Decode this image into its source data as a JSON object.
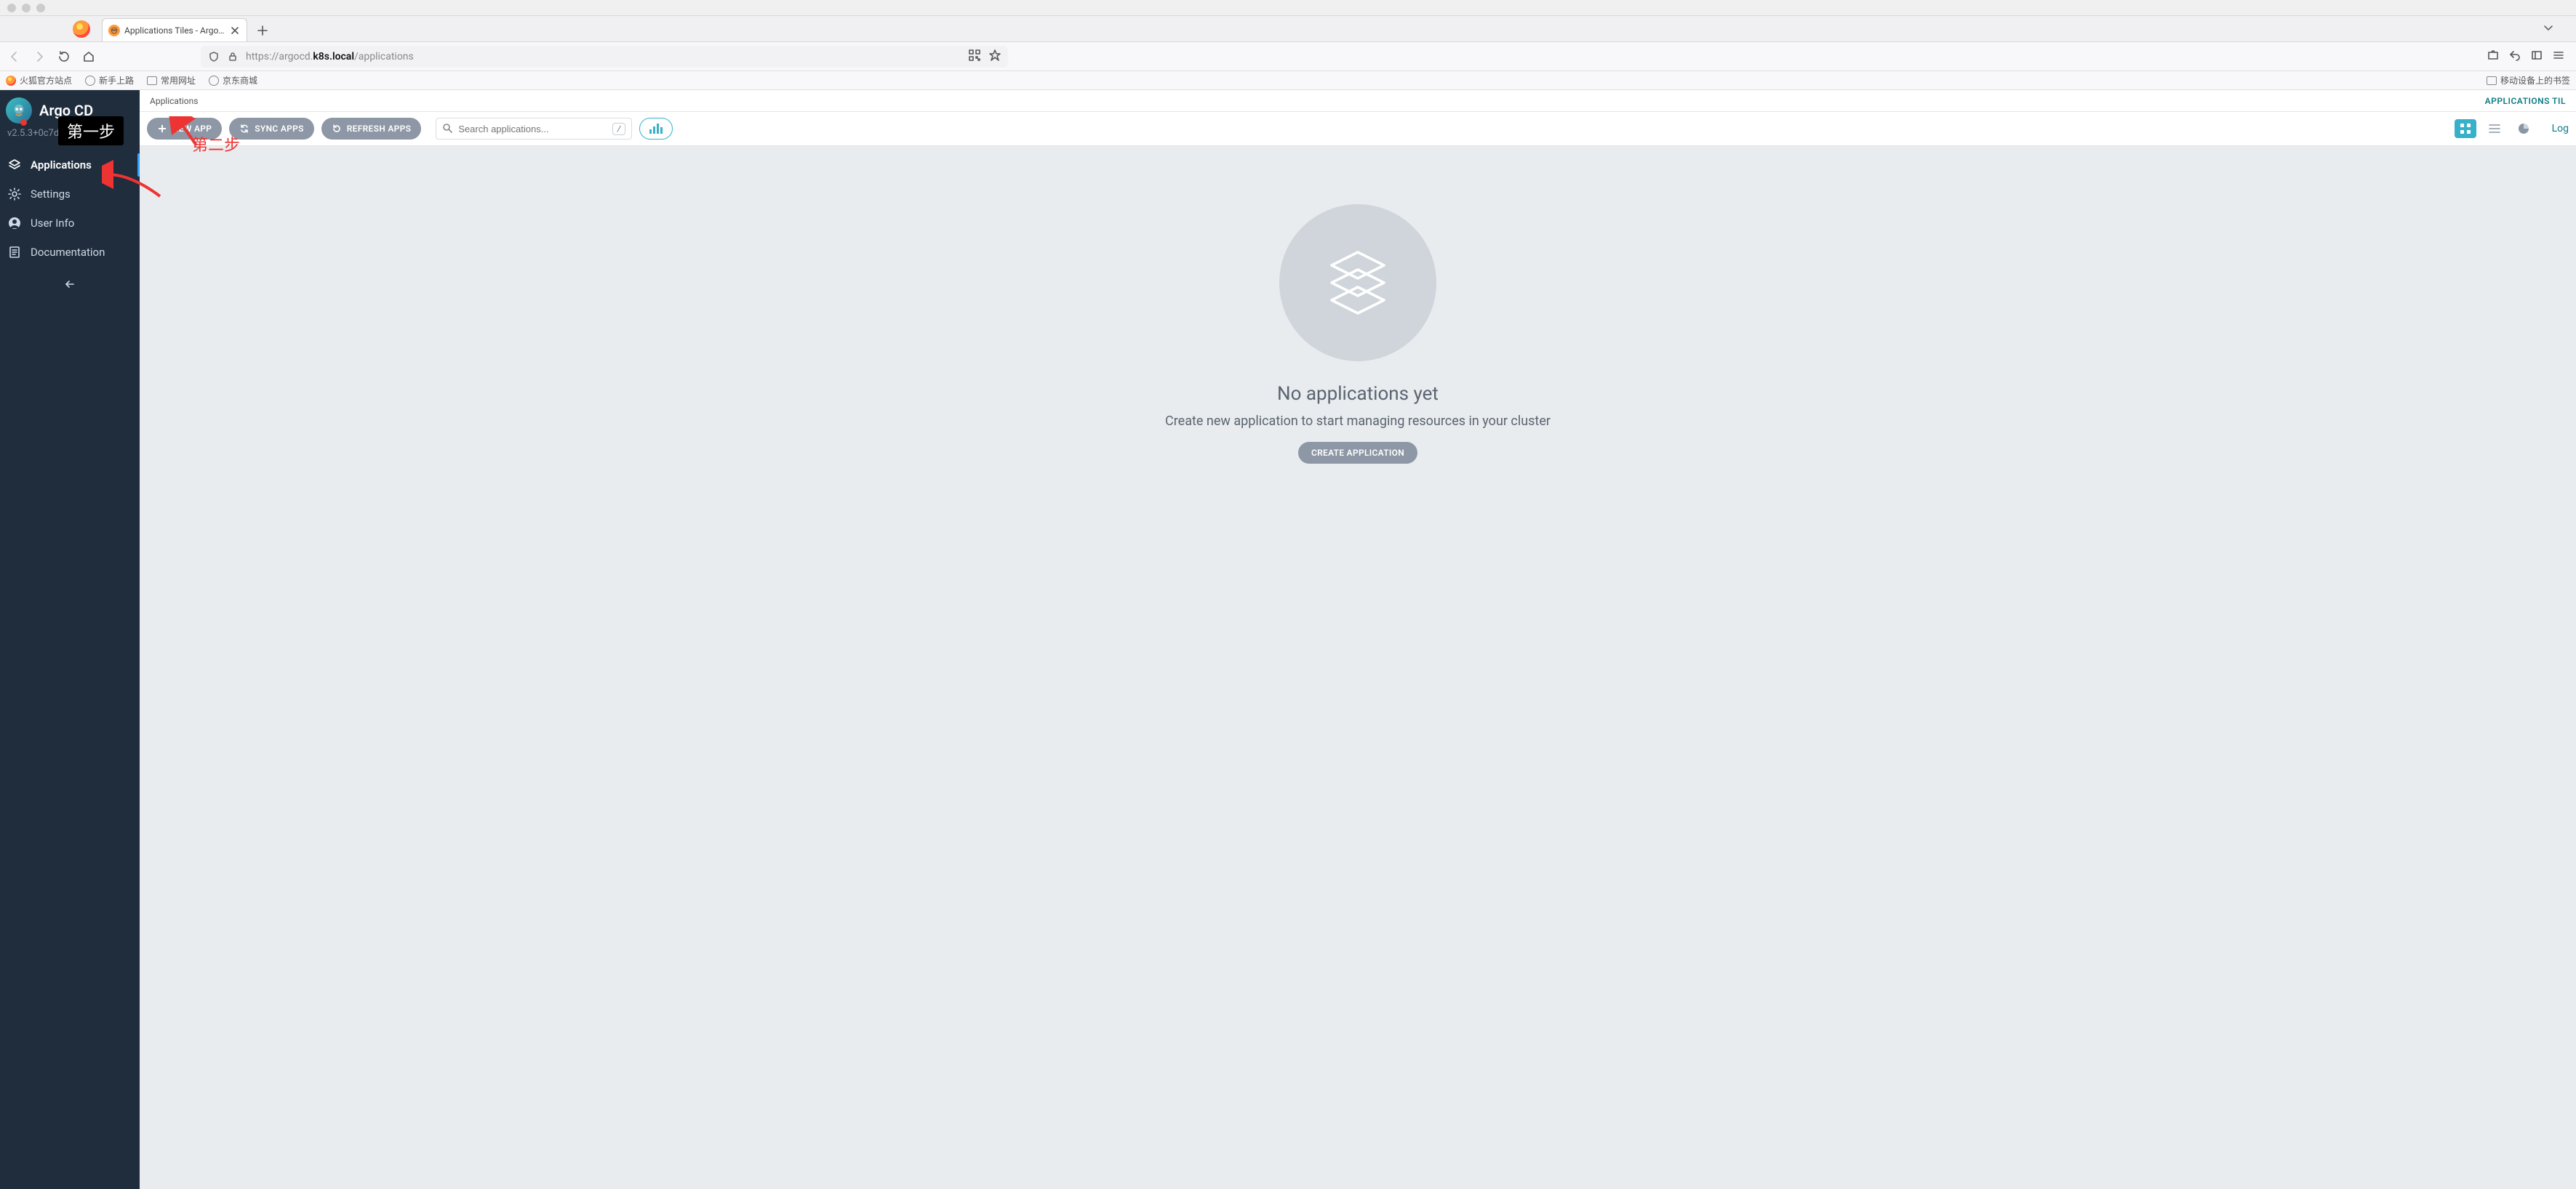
{
  "browser": {
    "tab_title": "Applications Tiles - Argo CD",
    "url_prefix": "https://argocd.",
    "url_bold": "k8s.local",
    "url_suffix": "/applications"
  },
  "bookmarks": {
    "b1": "火狐官方站点",
    "b2": "新手上路",
    "b3": "常用网址",
    "b4": "京东商城",
    "b5": "移动设备上的书签"
  },
  "sidebar": {
    "title": "Argo CD",
    "version": "v2.5.3+0c7de21",
    "nav": {
      "applications": "Applications",
      "settings": "Settings",
      "userinfo": "User Info",
      "documentation": "Documentation"
    }
  },
  "crumb": {
    "label": "Applications",
    "right": "APPLICATIONS TIL"
  },
  "toolbar": {
    "new_app": "NEW APP",
    "sync_apps": "SYNC APPS",
    "refresh_apps": "REFRESH APPS",
    "search_placeholder": "Search applications...",
    "kbd": "/",
    "log": "Log "
  },
  "empty": {
    "title": "No applications yet",
    "subtitle": "Create new application to start managing resources in your cluster",
    "button": "CREATE APPLICATION"
  },
  "annotations": {
    "step1": "第一步",
    "step2": "第二步"
  }
}
